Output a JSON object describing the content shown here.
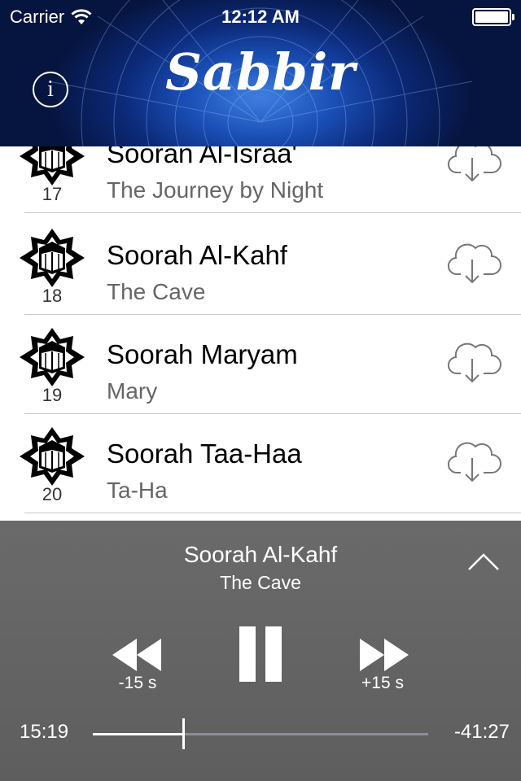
{
  "status": {
    "carrier": "Carrier",
    "time": "12:12 AM"
  },
  "header": {
    "title": "Sabbir",
    "info_label": "i"
  },
  "list": {
    "items": [
      {
        "number": "17",
        "title": "Sooran Al-Israa'",
        "subtitle": "The Journey by Night"
      },
      {
        "number": "18",
        "title": "Soorah Al-Kahf",
        "subtitle": "The Cave"
      },
      {
        "number": "19",
        "title": "Soorah Maryam",
        "subtitle": "Mary"
      },
      {
        "number": "20",
        "title": "Soorah Taa-Haa",
        "subtitle": "Ta-Ha"
      }
    ]
  },
  "player": {
    "title": "Soorah Al-Kahf",
    "subtitle": "The Cave",
    "rewind_label": "-15 s",
    "forward_label": "+15 s",
    "elapsed": "15:19",
    "remaining": "-41:27",
    "progress_fraction": 0.27
  },
  "icons": {
    "info": "info-icon",
    "emblem": "kaaba-star-icon",
    "download": "cloud-download-icon",
    "collapse": "chevron-up-icon",
    "rewind": "rewind-icon",
    "pause": "pause-icon",
    "forward": "fast-forward-icon",
    "wifi": "wifi-icon",
    "battery": "battery-icon"
  },
  "colors": {
    "header_blue": "#1a4fb6",
    "player_bg": "#646464",
    "divider": "#c8c8cc"
  }
}
